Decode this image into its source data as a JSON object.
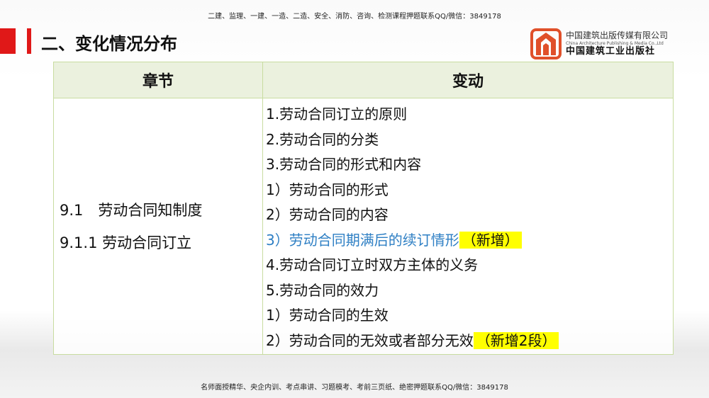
{
  "banners": {
    "top": "二建、监理、一建、一造、二造、安全、消防、咨询、检测课程押题联系QQ/微信：3849178",
    "bottom": "名师面授精华、央企内训、考点串讲、习题模考、考前三页纸、绝密押题联系QQ/微信：3849178"
  },
  "slide": {
    "title": "二、变化情况分布"
  },
  "logo": {
    "name_cn": "中国建筑出版传媒有限公司",
    "name_en": "China Architecture Publishing & Media Co.,Ltd",
    "name_cn2": "中国建筑工业出版社"
  },
  "table": {
    "headers": [
      "章节",
      "变动"
    ],
    "chapter": [
      "9.1　劳动合同知制度",
      "9.1.1 劳动合同订立"
    ],
    "changes": [
      {
        "text": "1.劳动合同订立的原则"
      },
      {
        "text": "2.劳动合同的分类"
      },
      {
        "text": "3.劳动合同的形式和内容"
      },
      {
        "text": "1）劳动合同的形式"
      },
      {
        "text": "2）劳动合同的内容"
      },
      {
        "text": "3）劳动合同期满后的续订情形",
        "tag": "（新增）",
        "blue": true
      },
      {
        "text": "4.劳动合同订立时双方主体的义务"
      },
      {
        "text": "5.劳动合同的效力"
      },
      {
        "text": "1）劳动合同的生效"
      },
      {
        "text": "2）劳动合同的无效或者部分无效",
        "tag": "（新增2段）"
      }
    ]
  },
  "colors": {
    "accent_red": "#e01818",
    "blue_text": "#2e7fc4",
    "highlight": "#ffff00",
    "header_bg": "#ebf1de"
  }
}
